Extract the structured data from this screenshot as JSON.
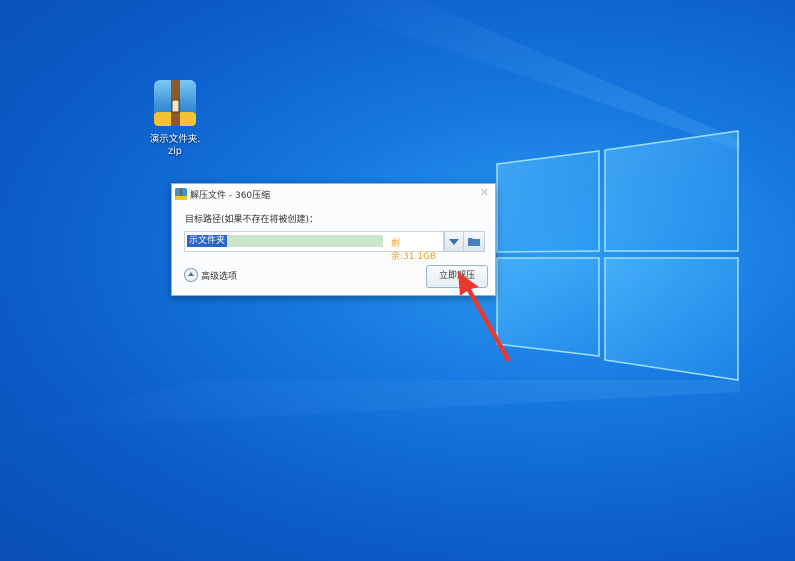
{
  "desktop": {
    "icon_label_line1": "演示文件夹.",
    "icon_label_line2": "zip"
  },
  "dialog": {
    "title": "解压文件 - 360压缩",
    "close_glyph": "✕",
    "path_label": "目标路径(如果不存在将被创建)：",
    "path_value_selected": "示文件夹",
    "space_left": "剩余:31.1GB",
    "advanced_label": "高级选项",
    "extract_button": "立即解压"
  },
  "icons": [
    "zip-archive-icon",
    "app-icon",
    "close-icon",
    "chevron-down-icon",
    "folder-icon",
    "expand-circle-icon",
    "red-pointer-arrow"
  ],
  "colors": {
    "space_text": "#f0a11a",
    "selection": "#2a64c8",
    "arrow": "#e8382f"
  }
}
